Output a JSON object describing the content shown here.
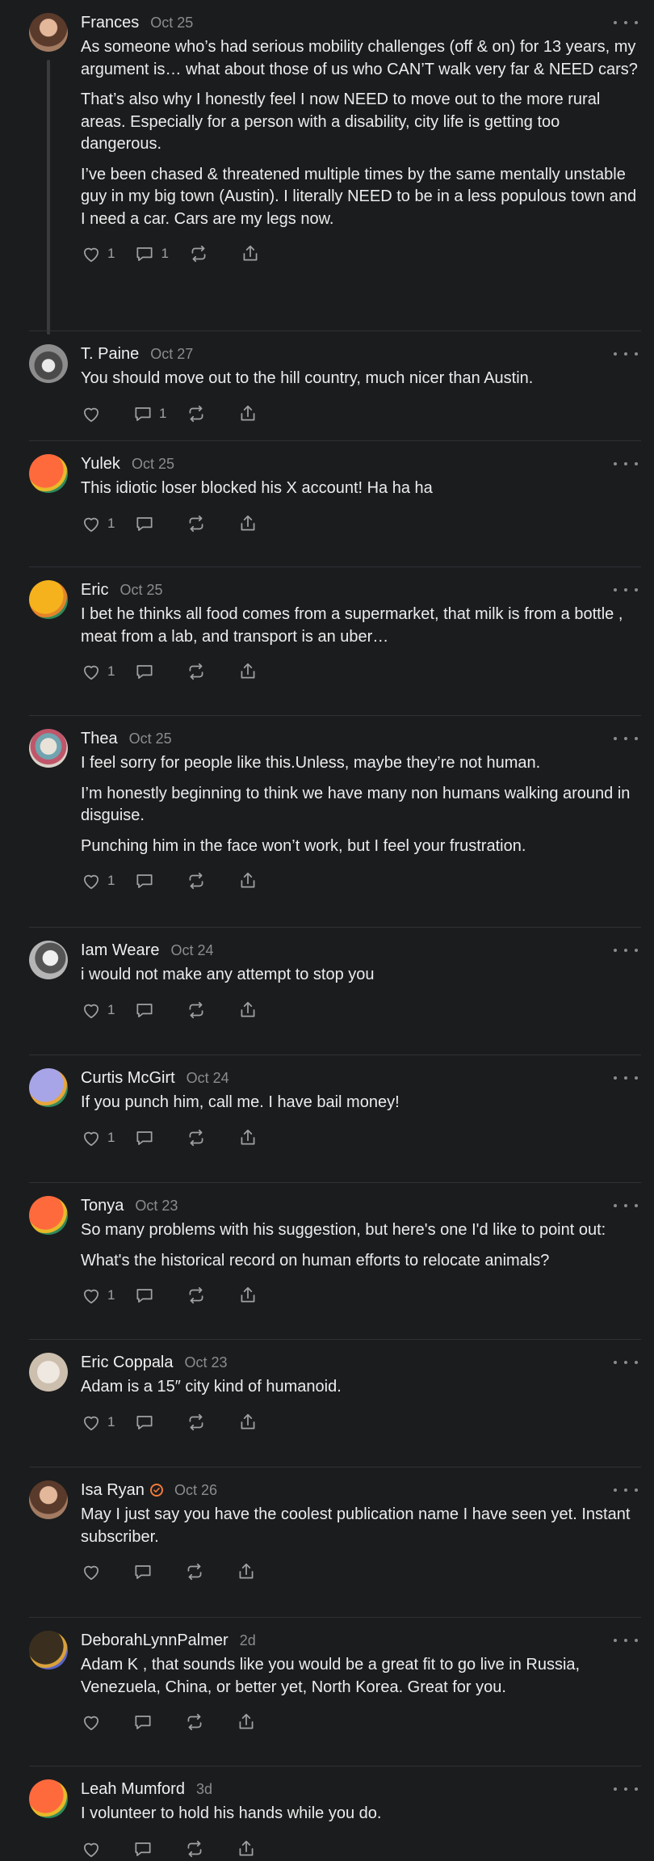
{
  "comments": [
    {
      "name": "Frances",
      "date": "Oct 25",
      "avatar_icon": "person-photo-avatar",
      "paragraphs": [
        "As someone who’s had serious mobility challenges (off & on) for 13 years, my argument is… what about those of us who CAN’T walk very far & NEED cars?",
        "That’s also why I honestly feel I now NEED to move out to the more rural areas. Especially for a person with a disability, city life is getting too dangerous.",
        "I’ve been chased & threatened multiple times by the same mentally unstable guy in my big town (Austin). I literally NEED to be in a less populous town and I need a car. Cars are my legs now."
      ],
      "likes": "1",
      "replies": "1"
    },
    {
      "name": "T. Paine",
      "date": "Oct 27",
      "avatar_icon": "cat-photo-avatar",
      "paragraphs": [
        "You should move out to the hill country, much nicer than Austin."
      ],
      "likes": "",
      "replies": "1"
    },
    {
      "name": "Yulek",
      "date": "Oct 25",
      "avatar_icon": "orange-gradient-avatar",
      "paragraphs": [
        "This idiotic loser blocked his X account! Ha ha ha"
      ],
      "likes": "1",
      "replies": ""
    },
    {
      "name": "Eric",
      "date": "Oct 25",
      "avatar_icon": "yellow-gradient-avatar",
      "paragraphs": [
        "I bet he thinks all food comes from a supermarket, that milk is from a bottle , meat from a lab, and transport is an uber…"
      ],
      "likes": "1",
      "replies": ""
    },
    {
      "name": "Thea",
      "date": "Oct 25",
      "avatar_icon": "illustrated-avatar",
      "paragraphs": [
        "I feel sorry for people like this.Unless, maybe they’re not human.",
        "I’m honestly beginning to think we have many non humans walking around in disguise.",
        "Punching him in the face won’t work, but I feel your frustration."
      ],
      "likes": "1",
      "replies": ""
    },
    {
      "name": "Iam Weare",
      "date": "Oct 24",
      "avatar_icon": "grayscale-photo-avatar",
      "paragraphs": [
        "i would not make any attempt to stop you"
      ],
      "likes": "1",
      "replies": ""
    },
    {
      "name": "Curtis McGirt",
      "date": "Oct 24",
      "avatar_icon": "lavender-gradient-avatar",
      "paragraphs": [
        "If you punch him, call me. I have bail money!"
      ],
      "likes": "1",
      "replies": ""
    },
    {
      "name": "Tonya",
      "date": "Oct 23",
      "avatar_icon": "orange-gradient-avatar",
      "paragraphs": [
        "So many problems with his suggestion, but here's one I'd like to point out:",
        "What's the historical record on human efforts to relocate animals?"
      ],
      "likes": "1",
      "replies": ""
    },
    {
      "name": "Eric Coppala",
      "date": "Oct 23",
      "avatar_icon": "dog-photo-avatar",
      "paragraphs": [
        "Adam is a 15″ city kind of humanoid."
      ],
      "likes": "1",
      "replies": ""
    },
    {
      "name": "Isa Ryan",
      "date": "Oct 26",
      "avatar_icon": "person-photo-avatar",
      "verified": true,
      "paragraphs": [
        "May I just say you have the coolest publication name I have seen yet. Instant subscriber."
      ],
      "likes": "",
      "replies": ""
    },
    {
      "name": "DeborahLynnPalmer",
      "date": "2d",
      "avatar_icon": "dark-gradient-avatar",
      "paragraphs": [
        "Adam K , that sounds like you would be a great fit to go live in Russia, Venezuela, China, or better yet, North Korea. Great for you."
      ],
      "likes": "",
      "replies": ""
    },
    {
      "name": "Leah Mumford",
      "date": "3d",
      "avatar_icon": "orange-gradient-avatar",
      "paragraphs": [
        "I volunteer to hold his hands while you do."
      ],
      "likes": "",
      "replies": ""
    }
  ],
  "colors": {
    "background": "#1b1c1e",
    "text": "#ececec",
    "muted": "#8b8c8f",
    "separator": "#2f3134",
    "verified": "#f07a3a"
  }
}
